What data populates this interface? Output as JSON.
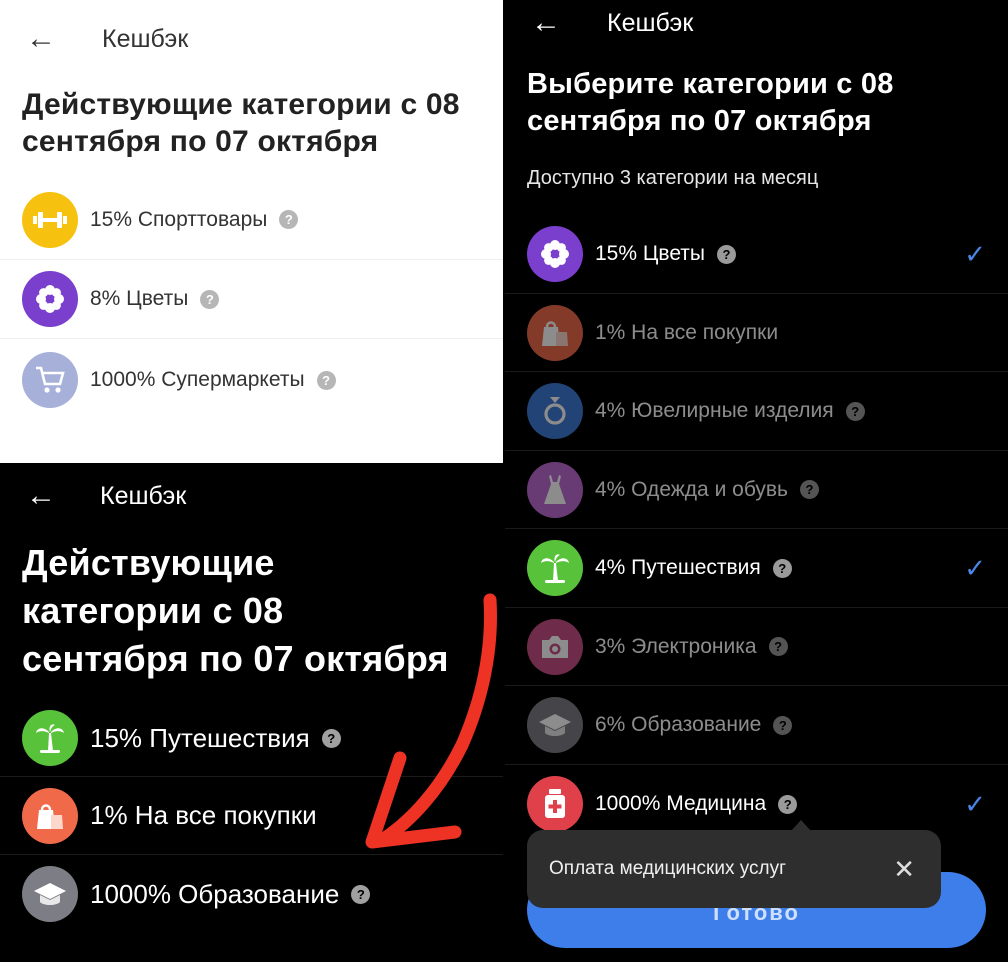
{
  "colors": {
    "sport": "#f7c20f",
    "flowers": "#7b3fce",
    "supermarkets": "#a6b0d8",
    "travel": "#58c23a",
    "purchases": "#f06a4a",
    "education": "#7d7d85",
    "jewelry": "#3c7bd6",
    "clothes": "#c06cd6",
    "electronics": "#c94f88",
    "medicine": "#e0404a",
    "accent_blue": "#3d7eea",
    "arrow_red": "#ee3224"
  },
  "panel_a": {
    "back_icon": "arrow-left-icon",
    "title": "Кешбэк",
    "heading": "Действующие категории с 08 сентября по 07 октября",
    "items": [
      {
        "label": "15% Спорттовары",
        "icon": "dumbbell-icon",
        "help": "?"
      },
      {
        "label": "8% Цветы",
        "icon": "flower-icon",
        "help": "?"
      },
      {
        "label": "1000% Супермаркеты",
        "icon": "cart-icon",
        "help": "?"
      }
    ]
  },
  "panel_b": {
    "back_icon": "arrow-left-icon",
    "title": "Кешбэк",
    "heading_lines": [
      "Действующие",
      "категории с 08",
      "сентября по 07 октября"
    ],
    "items": [
      {
        "label": "15% Путешествия",
        "icon": "palm-tree-icon",
        "help": "?"
      },
      {
        "label": "1% На все покупки",
        "icon": "shopping-bag-icon",
        "help": ""
      },
      {
        "label": "1000% Образование",
        "icon": "graduation-cap-icon",
        "help": "?"
      }
    ]
  },
  "panel_c": {
    "back_icon": "arrow-left-icon",
    "title": "Кешбэк",
    "heading_lines": [
      "Выберите категории с 08",
      "сентября по 07 октября"
    ],
    "subtitle": "Доступно 3 категории на месяц",
    "items": [
      {
        "label": "15% Цветы",
        "icon": "flower-icon",
        "help": "?",
        "selected": true
      },
      {
        "label": "1% На все покупки",
        "icon": "shopping-bag-icon",
        "help": "",
        "selected": false
      },
      {
        "label": "4% Ювелирные изделия",
        "icon": "ring-icon",
        "help": "?",
        "selected": false
      },
      {
        "label": "4% Одежда и обувь",
        "icon": "dress-icon",
        "help": "?",
        "selected": false
      },
      {
        "label": "4% Путешествия",
        "icon": "palm-tree-icon",
        "help": "?",
        "selected": true
      },
      {
        "label": "3% Электроника",
        "icon": "camera-icon",
        "help": "?",
        "selected": false
      },
      {
        "label": "6% Образование",
        "icon": "graduation-cap-icon",
        "help": "?",
        "selected": false
      },
      {
        "label": "1000% Медицина",
        "icon": "medicine-icon",
        "help": "?",
        "selected": true
      }
    ],
    "check_glyph": "✓",
    "tooltip": {
      "text": "Оплата медицинских услуг",
      "close": "✕"
    },
    "button_label": "Готово"
  }
}
